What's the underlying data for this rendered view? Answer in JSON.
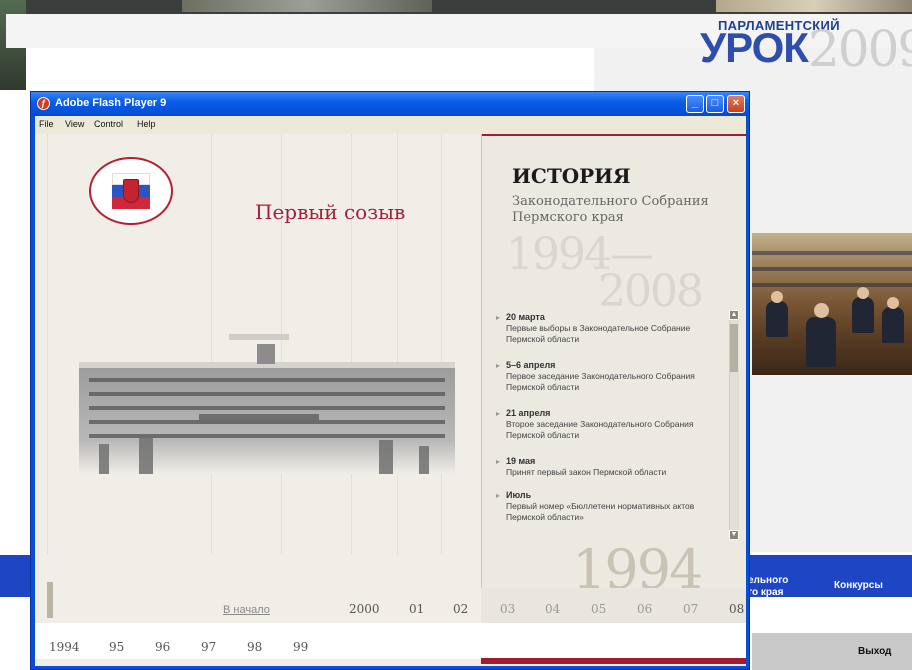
{
  "site": {
    "brand_small": "ПАРЛАМЕНТСКИЙ",
    "brand_big": "УРОК",
    "brand_year": "2009",
    "nav": [
      "ельного",
      "го края",
      "Конкурсы"
    ],
    "exit": "Выход"
  },
  "window": {
    "title": "Adobe Flash Player 9",
    "menu": [
      "File",
      "View",
      "Control",
      "Help"
    ],
    "buttons": {
      "minimize": "_",
      "maximize": "□",
      "close": "×"
    }
  },
  "flash": {
    "heading": "Первый созыв",
    "history": {
      "title": "ИСТОРИЯ",
      "subtitle": "Законодательного Собрания Пермского края",
      "range_start": "1994—",
      "range_end": "2008",
      "events": [
        {
          "date": "20 марта",
          "text": "Первые выборы в Законодательное Собрание Пермской области"
        },
        {
          "date": "5–6 апреля",
          "text": "Первое заседание Законодательного Собрания Пермской области"
        },
        {
          "date": "21 апреля",
          "text": "Второе заседание Законодательного Собрания Пермской области"
        },
        {
          "date": "19 мая",
          "text": "Принят первый закон Пермской области"
        },
        {
          "date": "Июль",
          "text": "Первый номер «Бюллетени нормативных актов Пермской области»"
        }
      ],
      "year_watermark": "1994"
    },
    "timeline": {
      "start_label": "В начало",
      "row1": [
        "2000",
        "01",
        "02",
        "03",
        "04",
        "05",
        "06",
        "07",
        "08"
      ],
      "row2": [
        "1994",
        "95",
        "96",
        "97",
        "98",
        "99"
      ]
    }
  }
}
